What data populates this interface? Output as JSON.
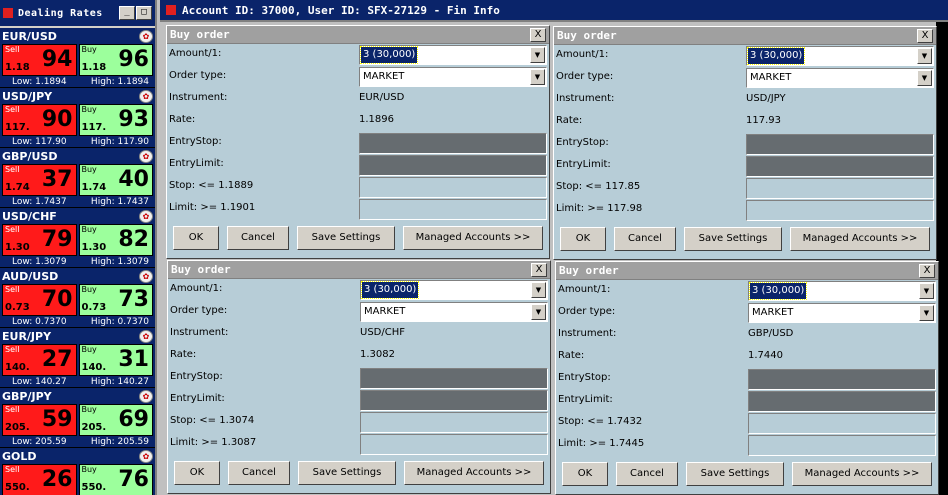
{
  "rates_window": {
    "title": "Dealing Rates",
    "min_btn": "_",
    "max_btn": "□"
  },
  "pairs": [
    {
      "name": "EUR/USD",
      "sell_label": "Sell",
      "sell_small": "1.18",
      "sell_big": "94",
      "buy_label": "Buy",
      "buy_small": "1.18",
      "buy_big": "96",
      "low": "Low: 1.1894",
      "high": "High: 1.1894"
    },
    {
      "name": "USD/JPY",
      "sell_label": "Sell",
      "sell_small": "117.",
      "sell_big": "90",
      "buy_label": "Buy",
      "buy_small": "117.",
      "buy_big": "93",
      "low": "Low: 117.90",
      "high": "High: 117.90"
    },
    {
      "name": "GBP/USD",
      "sell_label": "Sell",
      "sell_small": "1.74",
      "sell_big": "37",
      "buy_label": "Buy",
      "buy_small": "1.74",
      "buy_big": "40",
      "low": "Low: 1.7437",
      "high": "High: 1.7437"
    },
    {
      "name": "USD/CHF",
      "sell_label": "Sell",
      "sell_small": "1.30",
      "sell_big": "79",
      "buy_label": "Buy",
      "buy_small": "1.30",
      "buy_big": "82",
      "low": "Low: 1.3079",
      "high": "High: 1.3079"
    },
    {
      "name": "AUD/USD",
      "sell_label": "Sell",
      "sell_small": "0.73",
      "sell_big": "70",
      "buy_label": "Buy",
      "buy_small": "0.73",
      "buy_big": "73",
      "low": "Low: 0.7370",
      "high": "High: 0.7370"
    },
    {
      "name": "EUR/JPY",
      "sell_label": "Sell",
      "sell_small": "140.",
      "sell_big": "27",
      "buy_label": "Buy",
      "buy_small": "140.",
      "buy_big": "31",
      "low": "Low: 140.27",
      "high": "High: 140.27"
    },
    {
      "name": "GBP/JPY",
      "sell_label": "Sell",
      "sell_small": "205.",
      "sell_big": "59",
      "buy_label": "Buy",
      "buy_small": "205.",
      "buy_big": "69",
      "low": "Low: 205.59",
      "high": "High: 205.59"
    },
    {
      "name": "GOLD",
      "sell_label": "Sell",
      "sell_small": "550.",
      "sell_big": "26",
      "buy_label": "Buy",
      "buy_small": "550.",
      "buy_big": "76",
      "low": "",
      "high": ""
    }
  ],
  "main_window": {
    "title": "Account ID: 37000, User ID: SFX-27129 - Fin Info"
  },
  "dialogs": [
    {
      "title": "Buy order",
      "close": "X",
      "amount_label": "Amount/1:",
      "amount_value": "3 (30,000)",
      "order_type_label": "Order type:",
      "order_type_value": "MARKET",
      "instrument_label": "Instrument:",
      "instrument_value": "EUR/USD",
      "rate_label": "Rate:",
      "rate_value": "1.1896",
      "entry_stop_label": "EntryStop:",
      "entry_limit_label": "EntryLimit:",
      "stop_label": "Stop: <= 1.1889",
      "limit_label": "Limit: >= 1.1901",
      "ok": "OK",
      "cancel": "Cancel",
      "save": "Save Settings",
      "managed": "Managed Accounts >>"
    },
    {
      "title": "Buy order",
      "close": "X",
      "amount_label": "Amount/1:",
      "amount_value": "3 (30,000)",
      "order_type_label": "Order type:",
      "order_type_value": "MARKET",
      "instrument_label": "Instrument:",
      "instrument_value": "USD/JPY",
      "rate_label": "Rate:",
      "rate_value": "117.93",
      "entry_stop_label": "EntryStop:",
      "entry_limit_label": "EntryLimit:",
      "stop_label": "Stop: <= 117.85",
      "limit_label": "Limit: >= 117.98",
      "ok": "OK",
      "cancel": "Cancel",
      "save": "Save Settings",
      "managed": "Managed Accounts >>"
    },
    {
      "title": "Buy order",
      "close": "X",
      "amount_label": "Amount/1:",
      "amount_value": "3 (30,000)",
      "order_type_label": "Order type:",
      "order_type_value": "MARKET",
      "instrument_label": "Instrument:",
      "instrument_value": "USD/CHF",
      "rate_label": "Rate:",
      "rate_value": "1.3082",
      "entry_stop_label": "EntryStop:",
      "entry_limit_label": "EntryLimit:",
      "stop_label": "Stop: <= 1.3074",
      "limit_label": "Limit: >= 1.3087",
      "ok": "OK",
      "cancel": "Cancel",
      "save": "Save Settings",
      "managed": "Managed Accounts >>"
    },
    {
      "title": "Buy order",
      "close": "X",
      "amount_label": "Amount/1:",
      "amount_value": "3 (30,000)",
      "order_type_label": "Order type:",
      "order_type_value": "MARKET",
      "instrument_label": "Instrument:",
      "instrument_value": "GBP/USD",
      "rate_label": "Rate:",
      "rate_value": "1.7440",
      "entry_stop_label": "EntryStop:",
      "entry_limit_label": "EntryLimit:",
      "stop_label": "Stop: <= 1.7432",
      "limit_label": "Limit: >= 1.7445",
      "ok": "OK",
      "cancel": "Cancel",
      "save": "Save Settings",
      "managed": "Managed Accounts >>"
    }
  ]
}
